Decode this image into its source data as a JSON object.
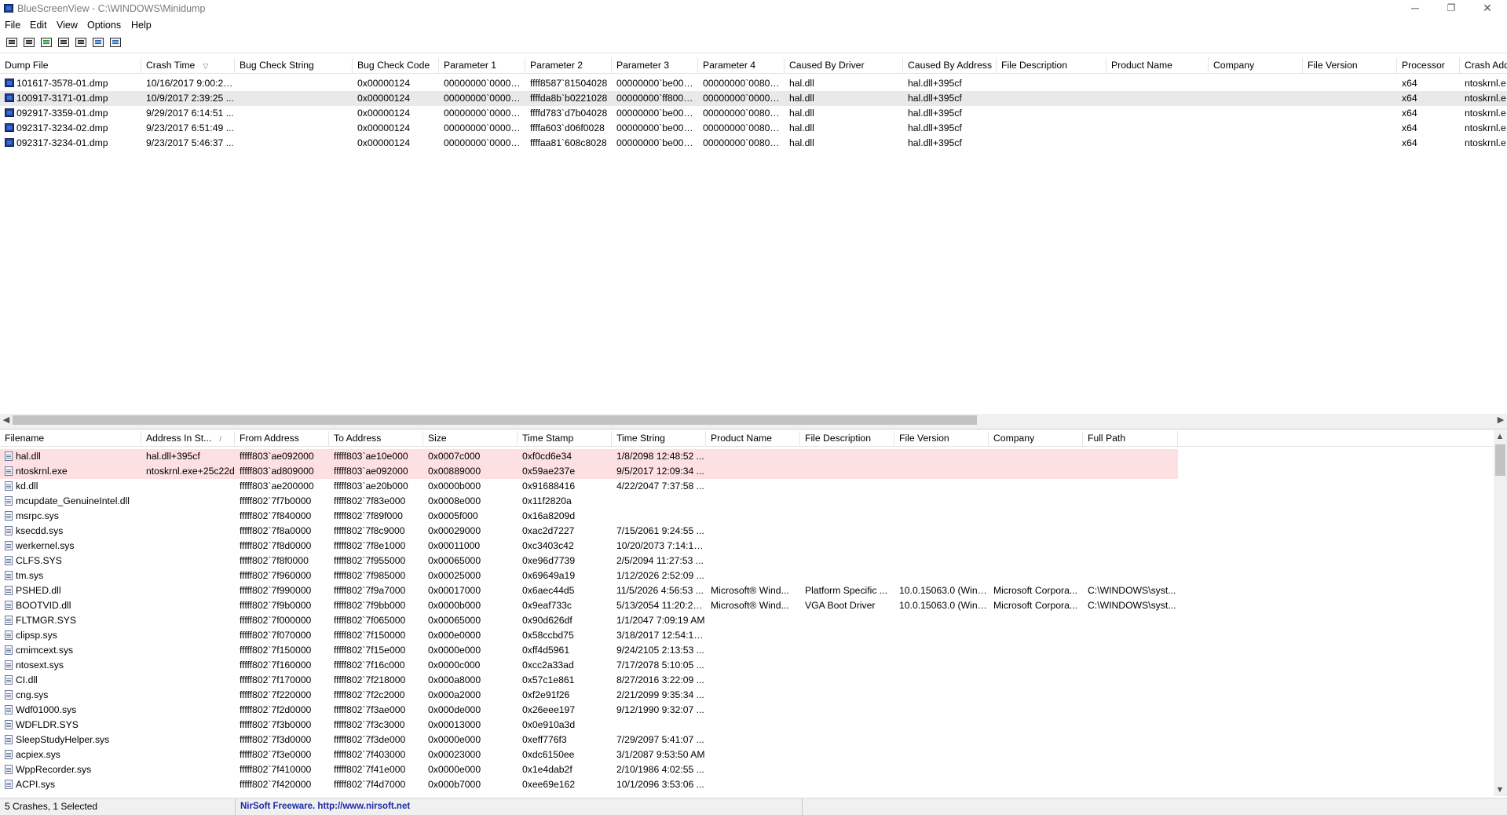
{
  "app": {
    "title": "BlueScreenView  -  C:\\WINDOWS\\Minidump",
    "window_buttons": {
      "minimize": "─",
      "restore": "❐",
      "close": "✕"
    }
  },
  "menu": [
    "File",
    "Edit",
    "View",
    "Options",
    "Help"
  ],
  "toolbar": [
    {
      "name": "properties-icon",
      "color": "plain"
    },
    {
      "name": "save-icon",
      "color": "plain"
    },
    {
      "name": "refresh-icon",
      "color": "green"
    },
    {
      "name": "copy-icon",
      "color": "plain"
    },
    {
      "name": "html-report-icon",
      "color": "plain"
    },
    {
      "name": "find-icon",
      "color": "blue"
    },
    {
      "name": "exit-icon",
      "color": "blue"
    }
  ],
  "crashes": {
    "columns": [
      "Dump File",
      "Crash Time",
      "Bug Check String",
      "Bug Check Code",
      "Parameter 1",
      "Parameter 2",
      "Parameter 3",
      "Parameter 4",
      "Caused By Driver",
      "Caused By Address",
      "File Description",
      "Product Name",
      "Company",
      "File Version",
      "Processor",
      "Crash Address"
    ],
    "sort_arrow": "▽",
    "rows": [
      [
        "101617-3578-01.dmp",
        "10/16/2017 9:00:20...",
        "",
        "0x00000124",
        "00000000`000000...",
        "ffff8587`81504028",
        "00000000`be0000...",
        "00000000`008004...",
        "hal.dll",
        "hal.dll+395cf",
        "",
        "",
        "",
        "",
        "x64",
        "ntoskrnl.e"
      ],
      [
        "100917-3171-01.dmp",
        "10/9/2017 2:39:25 ...",
        "",
        "0x00000124",
        "00000000`000000...",
        "ffffda8b`b0221028",
        "00000000`ff800000",
        "00000000`000001...",
        "hal.dll",
        "hal.dll+395cf",
        "",
        "",
        "",
        "",
        "x64",
        "ntoskrnl.e"
      ],
      [
        "092917-3359-01.dmp",
        "9/29/2017 6:14:51 ...",
        "",
        "0x00000124",
        "00000000`000000...",
        "ffffd783`d7b04028",
        "00000000`be0000...",
        "00000000`008004...",
        "hal.dll",
        "hal.dll+395cf",
        "",
        "",
        "",
        "",
        "x64",
        "ntoskrnl.e"
      ],
      [
        "092317-3234-02.dmp",
        "9/23/2017 6:51:49 ...",
        "",
        "0x00000124",
        "00000000`000000...",
        "ffffa603`d06f0028",
        "00000000`be0000...",
        "00000000`008004...",
        "hal.dll",
        "hal.dll+395cf",
        "",
        "",
        "",
        "",
        "x64",
        "ntoskrnl.e"
      ],
      [
        "092317-3234-01.dmp",
        "9/23/2017 5:46:37 ...",
        "",
        "0x00000124",
        "00000000`000000...",
        "ffffaa81`608c8028",
        "00000000`be0000...",
        "00000000`008004...",
        "hal.dll",
        "hal.dll+395cf",
        "",
        "",
        "",
        "",
        "x64",
        "ntoskrnl.e"
      ]
    ]
  },
  "drivers": {
    "columns": [
      "Filename",
      "Address In St...",
      "From Address",
      "To Address",
      "Size",
      "Time Stamp",
      "Time String",
      "Product Name",
      "File Description",
      "File Version",
      "Company",
      "Full Path"
    ],
    "sort_arrow": "/",
    "rows": [
      [
        "hal.dll",
        "hal.dll+395cf",
        "fffff803`ae092000",
        "fffff803`ae10e000",
        "0x0007c000",
        "0xf0cd6e34",
        "1/8/2098 12:48:52 ...",
        "",
        "",
        "",
        "",
        ""
      ],
      [
        "ntoskrnl.exe",
        "ntoskrnl.exe+25c22d",
        "fffff803`ad809000",
        "fffff803`ae092000",
        "0x00889000",
        "0x59ae237e",
        "9/5/2017 12:09:34 ...",
        "",
        "",
        "",
        "",
        ""
      ],
      [
        "kd.dll",
        "",
        "fffff803`ae200000",
        "fffff803`ae20b000",
        "0x0000b000",
        "0x91688416",
        "4/22/2047 7:37:58 ...",
        "",
        "",
        "",
        "",
        ""
      ],
      [
        "mcupdate_GenuineIntel.dll",
        "",
        "fffff802`7f7b0000",
        "fffff802`7f83e000",
        "0x0008e000",
        "0x11f2820a",
        "",
        "",
        "",
        "",
        "",
        ""
      ],
      [
        "msrpc.sys",
        "",
        "fffff802`7f840000",
        "fffff802`7f89f000",
        "0x0005f000",
        "0x16a8209d",
        "",
        "",
        "",
        "",
        "",
        ""
      ],
      [
        "ksecdd.sys",
        "",
        "fffff802`7f8a0000",
        "fffff802`7f8c9000",
        "0x00029000",
        "0xac2d7227",
        "7/15/2061 9:24:55 ...",
        "",
        "",
        "",
        "",
        ""
      ],
      [
        "werkernel.sys",
        "",
        "fffff802`7f8d0000",
        "fffff802`7f8e1000",
        "0x00011000",
        "0xc3403c42",
        "10/20/2073 7:14:10...",
        "",
        "",
        "",
        "",
        ""
      ],
      [
        "CLFS.SYS",
        "",
        "fffff802`7f8f0000",
        "fffff802`7f955000",
        "0x00065000",
        "0xe96d7739",
        "2/5/2094 11:27:53 ...",
        "",
        "",
        "",
        "",
        ""
      ],
      [
        "tm.sys",
        "",
        "fffff802`7f960000",
        "fffff802`7f985000",
        "0x00025000",
        "0x69649a19",
        "1/12/2026 2:52:09 ...",
        "",
        "",
        "",
        "",
        ""
      ],
      [
        "PSHED.dll",
        "",
        "fffff802`7f990000",
        "fffff802`7f9a7000",
        "0x00017000",
        "0x6aec44d5",
        "11/5/2026 4:56:53 ...",
        "Microsoft® Wind...",
        "Platform Specific ...",
        "10.0.15063.0 (WinB...",
        "Microsoft Corpora...",
        "C:\\WINDOWS\\syst..."
      ],
      [
        "BOOTVID.dll",
        "",
        "fffff802`7f9b0000",
        "fffff802`7f9bb000",
        "0x0000b000",
        "0x9eaf733c",
        "5/13/2054 11:20:28...",
        "Microsoft® Wind...",
        "VGA Boot Driver",
        "10.0.15063.0 (WinB...",
        "Microsoft Corpora...",
        "C:\\WINDOWS\\syst..."
      ],
      [
        "FLTMGR.SYS",
        "",
        "fffff802`7f000000",
        "fffff802`7f065000",
        "0x00065000",
        "0x90d626df",
        "1/1/2047 7:09:19 AM",
        "",
        "",
        "",
        "",
        ""
      ],
      [
        "clipsp.sys",
        "",
        "fffff802`7f070000",
        "fffff802`7f150000",
        "0x000e0000",
        "0x58ccbd75",
        "3/18/2017 12:54:13...",
        "",
        "",
        "",
        "",
        ""
      ],
      [
        "cmimcext.sys",
        "",
        "fffff802`7f150000",
        "fffff802`7f15e000",
        "0x0000e000",
        "0xff4d5961",
        "9/24/2105 2:13:53 ...",
        "",
        "",
        "",
        "",
        ""
      ],
      [
        "ntosext.sys",
        "",
        "fffff802`7f160000",
        "fffff802`7f16c000",
        "0x0000c000",
        "0xcc2a33ad",
        "7/17/2078 5:10:05 ...",
        "",
        "",
        "",
        "",
        ""
      ],
      [
        "CI.dll",
        "",
        "fffff802`7f170000",
        "fffff802`7f218000",
        "0x000a8000",
        "0x57c1e861",
        "8/27/2016 3:22:09 ...",
        "",
        "",
        "",
        "",
        ""
      ],
      [
        "cng.sys",
        "",
        "fffff802`7f220000",
        "fffff802`7f2c2000",
        "0x000a2000",
        "0xf2e91f26",
        "2/21/2099 9:35:34 ...",
        "",
        "",
        "",
        "",
        ""
      ],
      [
        "Wdf01000.sys",
        "",
        "fffff802`7f2d0000",
        "fffff802`7f3ae000",
        "0x000de000",
        "0x26eee197",
        "9/12/1990 9:32:07 ...",
        "",
        "",
        "",
        "",
        ""
      ],
      [
        "WDFLDR.SYS",
        "",
        "fffff802`7f3b0000",
        "fffff802`7f3c3000",
        "0x00013000",
        "0x0e910a3d",
        "",
        "",
        "",
        "",
        "",
        ""
      ],
      [
        "SleepStudyHelper.sys",
        "",
        "fffff802`7f3d0000",
        "fffff802`7f3de000",
        "0x0000e000",
        "0xeff776f3",
        "7/29/2097 5:41:07 ...",
        "",
        "",
        "",
        "",
        ""
      ],
      [
        "acpiex.sys",
        "",
        "fffff802`7f3e0000",
        "fffff802`7f403000",
        "0x00023000",
        "0xdc6150ee",
        "3/1/2087 9:53:50 AM",
        "",
        "",
        "",
        "",
        ""
      ],
      [
        "WppRecorder.sys",
        "",
        "fffff802`7f410000",
        "fffff802`7f41e000",
        "0x0000e000",
        "0x1e4dab2f",
        "2/10/1986 4:02:55 ...",
        "",
        "",
        "",
        "",
        ""
      ],
      [
        "ACPI.sys",
        "",
        "fffff802`7f420000",
        "fffff802`7f4d7000",
        "0x000b7000",
        "0xee69e162",
        "10/1/2096 3:53:06 ...",
        "",
        "",
        "",
        "",
        ""
      ]
    ]
  },
  "status": {
    "count": "5 Crashes, 1 Selected",
    "credit": "NirSoft Freeware.  http://www.nirsoft.net",
    "credit_color": "#1a2aa8"
  },
  "colors": {
    "highlight_row": "#fde0e2",
    "selected_row": "#e9e9e9"
  }
}
